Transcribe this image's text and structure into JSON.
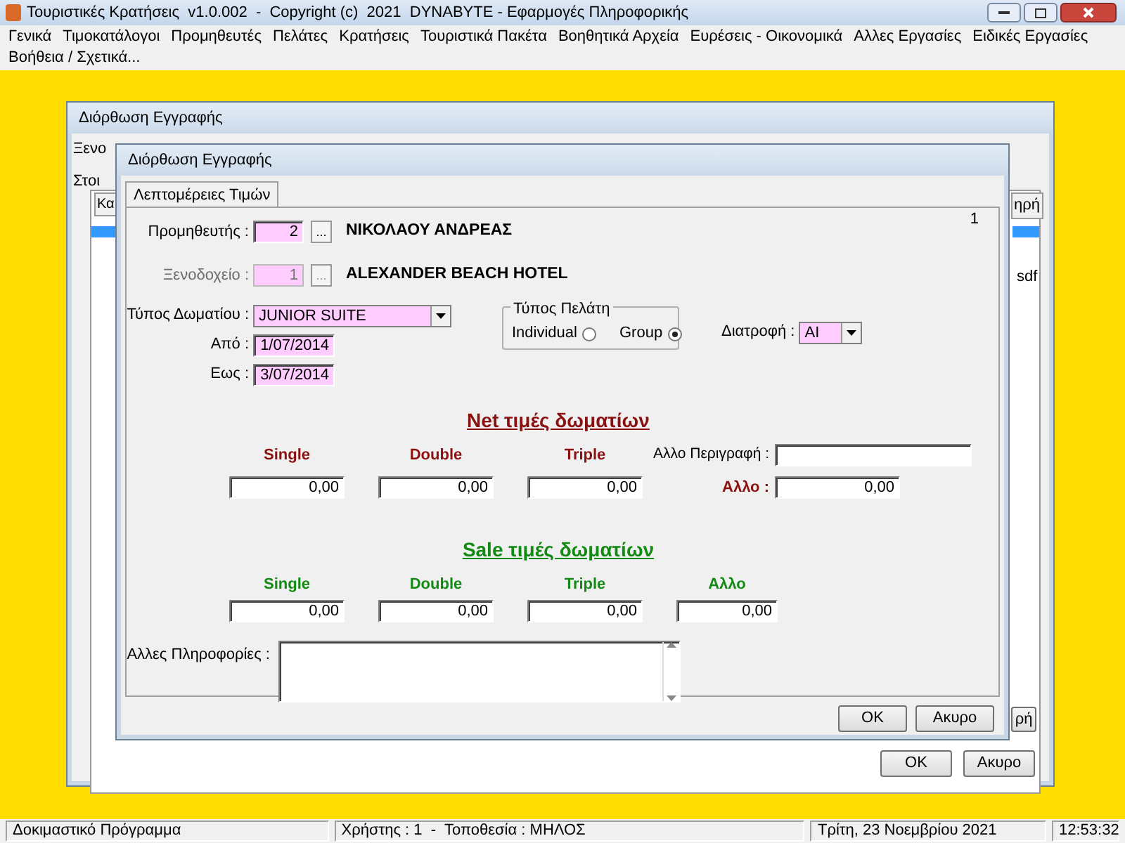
{
  "app_window": {
    "title": "Τουριστικές Κρατήσεις  v1.0.002  -  Copyright (c)  2021  DYNABYTE - Εφαρμογές Πληροφορικής"
  },
  "menu": [
    "Γενικά",
    "Τιμοκατάλογοι",
    "Προμηθευτές",
    "Πελάτες",
    "Κρατήσεις",
    "Τουριστικά Πακέτα",
    "Βοηθητικά Αρχεία",
    "Ευρέσεις - Οικονομικά",
    "Αλλες Εργασίες",
    "Ειδικές Εργασίες",
    "Βοήθεια / Σχετικά..."
  ],
  "back_dialog": {
    "title": "Διόρθωση Εγγραφής",
    "label_fragment": "Ξενο",
    "tab_fragment": "Στοι",
    "column_fragment": "Κα",
    "header_fragment": "ηρή",
    "cell_fragment": "sdf",
    "button_fragment": "ρή",
    "buttons": [
      "OK",
      "Ακυρο"
    ]
  },
  "dialog": {
    "title": "Διόρθωση Εγγραφής",
    "tabs": [
      {
        "label": "Λεπτομέρειες Τιμών",
        "selected": true
      }
    ],
    "record_number": "1",
    "supplier": {
      "label": "Προμηθευτής :",
      "code": "2",
      "lookup": "...",
      "name": "ΝΙΚΟΛΑΟΥ ΑΝΔΡΕΑΣ",
      "disabled": false
    },
    "hotel": {
      "label": "Ξενοδοχείο :",
      "code": "1",
      "lookup": "...",
      "name": "ALEXANDER BEACH HOTEL",
      "disabled": true
    },
    "room_type": {
      "label": "Τύπος Δωματίου :",
      "value": "JUNIOR SUITE"
    },
    "date_from": {
      "label": "Από :",
      "value": "1/07/2014"
    },
    "date_to": {
      "label": "Εως :",
      "value": "3/07/2014"
    },
    "customer_type": {
      "title": "Τύπος Πελάτη",
      "options": [
        {
          "label": "Individual",
          "selected": false
        },
        {
          "label": "Group",
          "selected": true
        }
      ]
    },
    "board": {
      "label": "Διατροφή :",
      "value": "AI"
    },
    "net_prices": {
      "title": "Net τιμές δωματίων",
      "columns": [
        {
          "label": "Single",
          "value": "0,00"
        },
        {
          "label": "Double",
          "value": "0,00"
        },
        {
          "label": "Triple",
          "value": "0,00"
        }
      ],
      "other_description_label": "Αλλο Περιγραφή :",
      "other_label": "Αλλο :",
      "other_value": "0,00"
    },
    "sale_prices": {
      "title": "Sale τιμές δωματίων",
      "columns": [
        {
          "label": "Single",
          "value": "0,00"
        },
        {
          "label": "Double",
          "value": "0,00"
        },
        {
          "label": "Triple",
          "value": "0,00"
        },
        {
          "label": "Αλλο",
          "value": "0,00"
        }
      ]
    },
    "other_info": {
      "label": "Αλλες Πληροφορίες :"
    },
    "buttons": [
      "OK",
      "Ακυρο"
    ]
  },
  "status_bar": [
    "Δοκιμαστικό Πρόγραμμα",
    "Χρήστης : 1  -  Τοποθεσία : ΜΗΛΟΣ",
    "Τρίτη, 23 Νοεμβρίου 2021",
    "12:53:32"
  ]
}
